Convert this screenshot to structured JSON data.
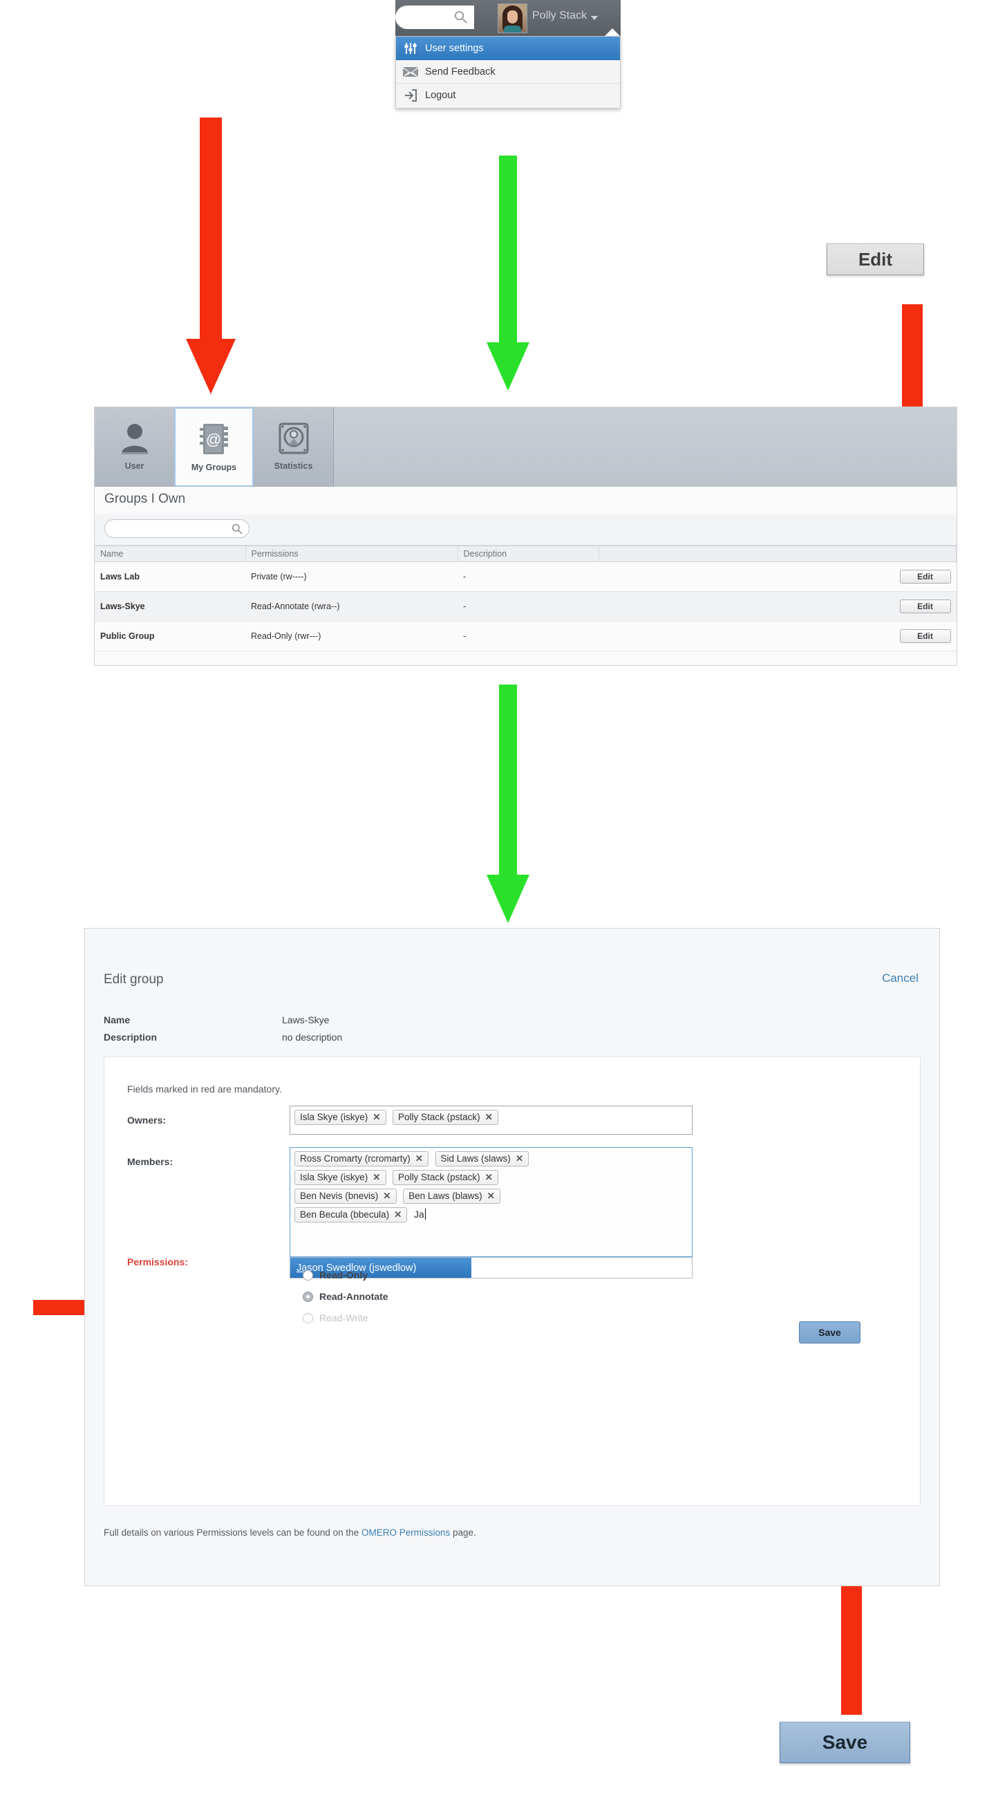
{
  "topbar": {
    "search_placeholder": "",
    "search_value": "",
    "username": "Polly Stack",
    "search_icon": "search-icon",
    "caret_icon": "chevron-down-icon",
    "avatar": "user-avatar-photo"
  },
  "user_menu": {
    "items": [
      {
        "label": "User settings",
        "icon": "sliders-icon",
        "selected": true
      },
      {
        "label": "Send Feedback",
        "icon": "envelope-icon",
        "selected": false
      },
      {
        "label": "Logout",
        "icon": "logout-arrow-icon",
        "selected": false
      }
    ]
  },
  "callouts": {
    "edit_button_label": "Edit",
    "save_button_label": "Save"
  },
  "groups_panel": {
    "tabs": [
      {
        "label": "User",
        "icon": "person-icon",
        "active": false
      },
      {
        "label": "My Groups",
        "icon": "address-book-at-icon",
        "active": true
      },
      {
        "label": "Statistics",
        "icon": "hard-disk-icon",
        "active": false
      }
    ],
    "title": "Groups I Own",
    "search_value": "",
    "search_placeholder": "",
    "search_icon": "search-icon",
    "columns": [
      "Name",
      "Permissions",
      "Description",
      ""
    ],
    "rows": [
      {
        "name": "Laws Lab",
        "permissions": "Private (rw----)",
        "description": "-",
        "action": "Edit"
      },
      {
        "name": "Laws-Skye",
        "permissions": "Read-Annotate (rwra--)",
        "description": "-",
        "action": "Edit"
      },
      {
        "name": "Public Group",
        "permissions": "Read-Only (rwr---)",
        "description": "-",
        "action": "Edit"
      }
    ]
  },
  "edit_dialog": {
    "title": "Edit group",
    "cancel_label": "Cancel",
    "meta": {
      "name_label": "Name",
      "name_value": "Laws-Skye",
      "description_label": "Description",
      "description_value": "no description"
    },
    "mandatory_note": "Fields marked in red are mandatory.",
    "owners_label": "Owners:",
    "owners": [
      {
        "label": "Isla Skye (iskye)",
        "remove": "✕"
      },
      {
        "label": "Polly Stack (pstack)",
        "remove": "✕"
      }
    ],
    "members_label": "Members:",
    "members": [
      {
        "label": "Ross Cromarty (rcromarty)",
        "remove": "✕"
      },
      {
        "label": "Sid Laws (slaws)",
        "remove": "✕"
      },
      {
        "label": "Isla Skye (iskye)",
        "remove": "✕"
      },
      {
        "label": "Polly Stack (pstack)",
        "remove": "✕"
      },
      {
        "label": "Ben Nevis (bnevis)",
        "remove": "✕"
      },
      {
        "label": "Ben Laws (blaws)",
        "remove": "✕"
      },
      {
        "label": "Ben Becula (bbecula)",
        "remove": "✕"
      }
    ],
    "members_input_value": "Ja",
    "autocomplete": {
      "match_prefix": "Ja",
      "rest": "son Swedlow (jswedlow)"
    },
    "permissions_label": "Permissions:",
    "permissions_options": [
      {
        "label": "Read-Only",
        "selected": false,
        "disabled": false
      },
      {
        "label": "Read-Annotate",
        "selected": true,
        "disabled": false
      },
      {
        "label": "Read-Write",
        "selected": false,
        "disabled": true
      }
    ],
    "save_label": "Save",
    "footer_prefix": "Full details on various Permissions levels can be found on the ",
    "footer_link": "OMERO Permissions",
    "footer_suffix": " page."
  },
  "colors": {
    "accent_blue": "#2d75bc",
    "arrow_red": "#f42d10",
    "arrow_green": "#2ae02a",
    "mandatory_red": "#d9433a",
    "link_blue": "#3a7fb5"
  }
}
